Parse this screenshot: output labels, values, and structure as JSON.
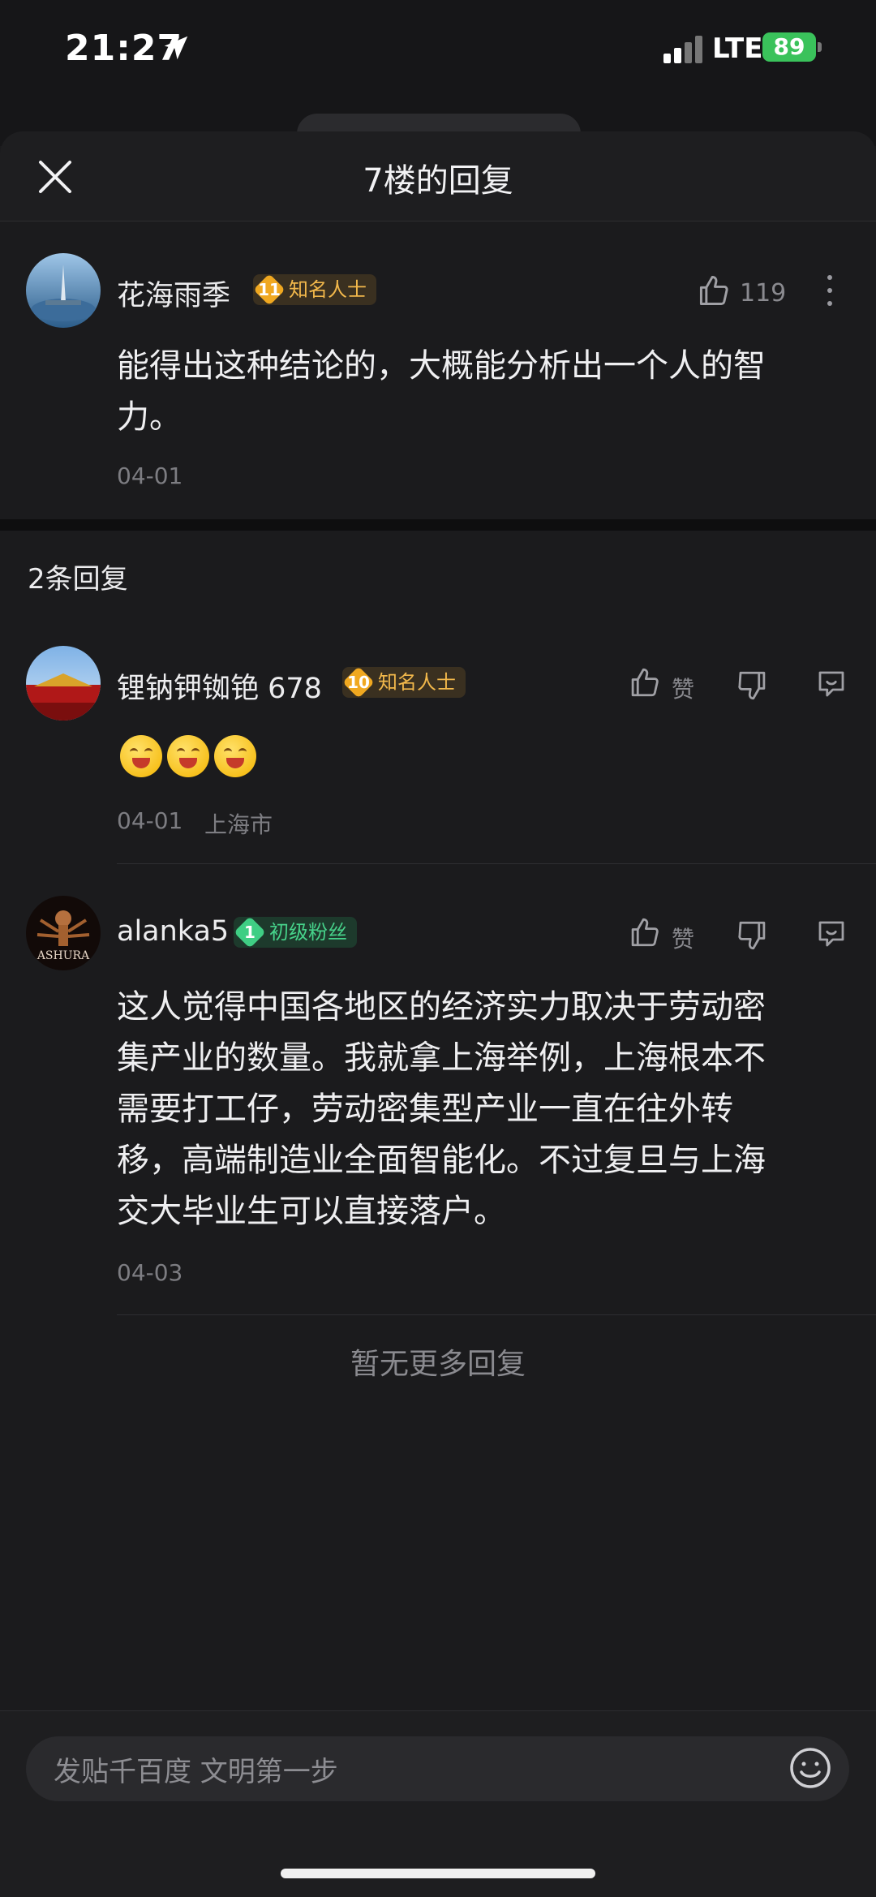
{
  "status_bar": {
    "time": "21:27",
    "network": "LTE",
    "battery": "89"
  },
  "sheet": {
    "title": "7楼的回复"
  },
  "main_comment": {
    "username": "花海雨季",
    "level": "11",
    "badge": "知名人士",
    "likes": "119",
    "text_line1": "能得出这种结论的，大概能分析出一个人的智",
    "text_line2": "力。",
    "date": "04-01"
  },
  "replies_header": "2条回复",
  "replies": [
    {
      "username": "锂钠钾铷铯 678",
      "level": "10",
      "badge": "知名人士",
      "like_label": "赞",
      "emojis": [
        "laugh-emoji",
        "laugh-emoji",
        "laugh-emoji"
      ],
      "date": "04-01",
      "location": "上海市"
    },
    {
      "username": "alanka5",
      "level": "1",
      "badge": "初级粉丝",
      "like_label": "赞",
      "lines": [
        "这人觉得中国各地区的经济实力取决于劳动密",
        "集产业的数量。我就拿上海举例，上海根本不",
        "需要打工仔，劳动密集型产业一直在往外转",
        "移，高端制造业全面智能化。不过复旦与上海",
        "交大毕业生可以直接落户。"
      ],
      "date": "04-03"
    }
  ],
  "no_more": "暂无更多回复",
  "input": {
    "placeholder": "发贴千百度 文明第一步"
  },
  "colors": {
    "background": "#1b1b1d",
    "gold_badge": "#f0a820",
    "green_badge": "#3fce84",
    "battery": "#3ac25b"
  }
}
